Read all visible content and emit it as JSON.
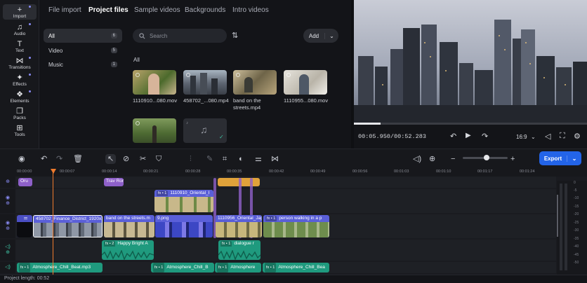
{
  "sidebar": {
    "items": [
      {
        "label": "Import",
        "icon": "plus-icon",
        "glyph": "+"
      },
      {
        "label": "Audio",
        "icon": "music-note-icon",
        "glyph": "♫"
      },
      {
        "label": "Text",
        "icon": "text-icon",
        "glyph": "T"
      },
      {
        "label": "Transitions",
        "icon": "transitions-icon",
        "glyph": "⋈"
      },
      {
        "label": "Effects",
        "icon": "effects-icon",
        "glyph": "✦"
      },
      {
        "label": "Elements",
        "icon": "elements-icon",
        "glyph": "❖"
      },
      {
        "label": "Packs",
        "icon": "packs-icon",
        "glyph": "❐"
      },
      {
        "label": "Tools",
        "icon": "tools-icon",
        "glyph": "⊞"
      }
    ]
  },
  "media_tabs": [
    "File import",
    "Project files",
    "Sample videos",
    "Backgrounds",
    "Intro videos"
  ],
  "categories": [
    {
      "label": "All",
      "count": "6"
    },
    {
      "label": "Video",
      "count": "5"
    },
    {
      "label": "Music",
      "count": "1"
    }
  ],
  "search": {
    "placeholder": "Search"
  },
  "add_button": {
    "label": "Add"
  },
  "section_label": "All",
  "media_items": [
    {
      "label": "1110910...080.mov"
    },
    {
      "label": "458702_...080.mp4"
    },
    {
      "label": "band on the streets.mp4"
    },
    {
      "label": "1110955...080.mov"
    },
    {
      "label": ""
    },
    {
      "label": ""
    }
  ],
  "preview": {
    "timecode": "00:05.950/00:52.283",
    "aspect": "16:9",
    "progress": 0.114
  },
  "export_button": {
    "label": "Export"
  },
  "ruler_ticks": [
    "00:00:00",
    "00:00:07",
    "00:00:14",
    "00:00:21",
    "00:00:28",
    "00:00:35",
    "00:00:42",
    "00:00:49",
    "00:00:56",
    "00:01:03",
    "00:01:10",
    "00:01:17",
    "00:01:24"
  ],
  "timeline": {
    "text_clips": [
      "Oru",
      "Trav Rom"
    ],
    "video_clips": [
      {
        "label": "1110910_Oriental_I",
        "fx": "fx • 1"
      },
      {
        "label": "458702_Finance_District_1920x1"
      },
      {
        "label": "band on the streets.m"
      },
      {
        "label": "9.png"
      },
      {
        "label": "1110956_Oriental_Jaj"
      },
      {
        "label": "person walking in a p",
        "fx": "fx • 1"
      }
    ],
    "audio_clips": [
      {
        "label": "Happy Bright A",
        "fx": "fx • 2"
      },
      {
        "label": "dialogue r",
        "fx": "fx • 1"
      }
    ],
    "music_clips": [
      {
        "label": "Atmosphere_Chill_Beat.mp3",
        "fx": "fx • 1"
      },
      {
        "label": "Atmosphere_Chill_B",
        "fx": "fx • 1"
      },
      {
        "label": "Atmosphere",
        "fx": "fx • 1"
      },
      {
        "label": "Atmosphere_Chill_Bea",
        "fx": "fx • 1"
      }
    ]
  },
  "meter_labels": [
    "0",
    "-5",
    "-10",
    "-15",
    "-20",
    "-25",
    "-30",
    "-35",
    "-40",
    "-45",
    "-50"
  ],
  "footer": {
    "project_length": "Project length: 00:52"
  },
  "colors": {
    "accent": "#2364e8",
    "video_clip": "#5a5fd8",
    "audio_clip": "#1f9a7e",
    "playhead": "#f07b2d",
    "text_clip": "#8e60c9",
    "overlay_clip": "#e0a23a"
  }
}
